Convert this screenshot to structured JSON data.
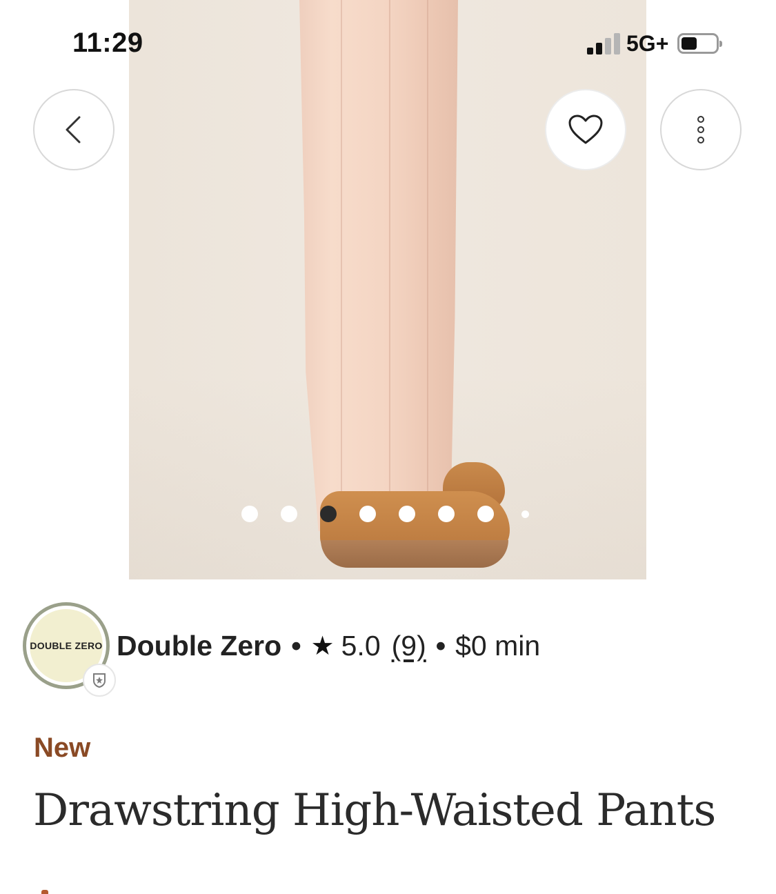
{
  "status_bar": {
    "time": "11:29",
    "network": "5G+",
    "signal_bars_active": 2,
    "signal_bars_total": 4,
    "battery_level": 0.45
  },
  "nav": {
    "back_icon": "chevron-left-icon",
    "favorite_icon": "heart-outline-icon",
    "more_icon": "more-vertical-icon"
  },
  "carousel": {
    "total_images": 8,
    "active_index": 2,
    "image_description_icon": "product-photo"
  },
  "seller": {
    "logo_text": "DOUBLE ZERO",
    "name": "Double Zero",
    "separator": "•",
    "rating": "5.0",
    "review_count": "(9)",
    "min_order": "$0 min",
    "badge_icon": "shield-star-icon"
  },
  "product": {
    "condition": "New",
    "title": "Drawstring High-Waisted Pants"
  },
  "colors": {
    "condition_text": "#8a4a25",
    "logo_ring": "#9aa08a",
    "logo_fill": "#f2efd0",
    "active_dot": "#2b2b2b"
  }
}
